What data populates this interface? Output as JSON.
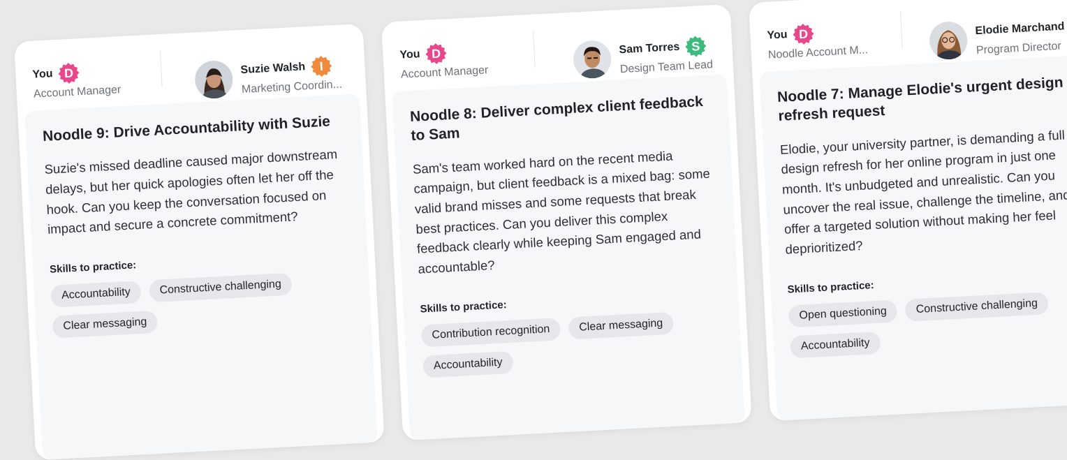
{
  "colors": {
    "you_badge": "#e8478b",
    "suzie_badge": "#ef8a3c",
    "sam_badge": "#3fba7d",
    "elodie_badge": "#e8478b"
  },
  "cards": [
    {
      "you": {
        "name": "You",
        "badge": "D",
        "role": "Account Manager"
      },
      "other": {
        "name": "Suzie Walsh",
        "badge": "I",
        "role": "Marketing Coordin..."
      },
      "title": "Noodle 9: Drive Accountability with Suzie",
      "description": "Suzie's missed deadline caused major downstream delays, but her quick apologies often let her off the hook. Can you keep the conversation focused on impact and secure a concrete commitment?",
      "skills_label": "Skills to practice:",
      "skills": [
        "Accountability",
        "Constructive challenging",
        "Clear messaging"
      ]
    },
    {
      "you": {
        "name": "You",
        "badge": "D",
        "role": "Account Manager"
      },
      "other": {
        "name": "Sam Torres",
        "badge": "S",
        "role": "Design Team Lead"
      },
      "title": "Noodle 8: Deliver complex client feedback to Sam",
      "description": "Sam's team worked hard on the recent media campaign, but client feedback is a mixed bag: some valid brand misses and some requests that break best practices. Can you deliver this complex feedback clearly while keeping Sam engaged and accountable?",
      "skills_label": "Skills to practice:",
      "skills": [
        "Contribution recognition",
        "Clear messaging",
        "Accountability"
      ]
    },
    {
      "you": {
        "name": "You",
        "badge": "D",
        "role": "Noodle Account M..."
      },
      "other": {
        "name": "Elodie Marchand",
        "badge": "",
        "role": "Program Director"
      },
      "title": "Noodle 7: Manage Elodie's urgent design refresh request",
      "description": "Elodie, your university partner, is demanding a full design refresh for her online program in just one month. It's unbudgeted and unrealistic. Can you uncover the real issue, challenge the timeline, and offer a targeted solution without making her feel deprioritized?",
      "skills_label": "Skills to practice:",
      "skills": [
        "Open questioning",
        "Constructive challenging",
        "Accountability"
      ]
    }
  ]
}
